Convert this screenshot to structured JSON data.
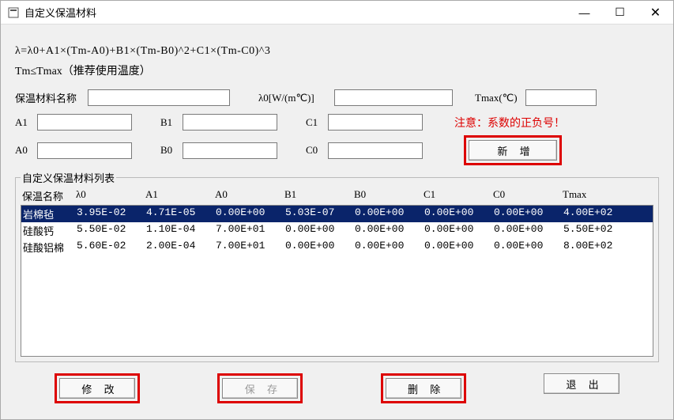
{
  "window": {
    "title": "自定义保温材料"
  },
  "formula": "λ=λ0+A1×(Tm-A0)+B1×(Tm-B0)^2+C1×(Tm-C0)^3",
  "subformula": "Tm≤Tmax（推荐使用温度）",
  "labels": {
    "name": "保温材料名称",
    "lambda0": "λ0[W/(m℃)]",
    "tmax": "Tmax(℃)",
    "a1": "A1",
    "b1": "B1",
    "c1": "C1",
    "a0": "A0",
    "b0": "B0",
    "c0": "C0",
    "warn": "注意：系数的正负号！"
  },
  "inputs": {
    "name": "",
    "lambda0": "",
    "tmax": "",
    "a1": "",
    "b1": "",
    "c1": "",
    "a0": "",
    "b0": "",
    "c0": ""
  },
  "buttons": {
    "add": "新 增",
    "modify": "修 改",
    "save": "保 存",
    "delete": "删 除",
    "exit": "退 出"
  },
  "list": {
    "legend": "自定义保温材料列表",
    "headers": [
      "保温名称",
      "λ0",
      "A1",
      "A0",
      "B1",
      "B0",
      "C1",
      "C0",
      "Tmax"
    ],
    "rows": [
      {
        "name": "岩棉毡",
        "l0": "3.95E-02",
        "a1": "4.71E-05",
        "a0": "0.00E+00",
        "b1": "5.03E-07",
        "b0": "0.00E+00",
        "c1": "0.00E+00",
        "c0": "0.00E+00",
        "tmax": "4.00E+02",
        "selected": true
      },
      {
        "name": "硅酸钙",
        "l0": "5.50E-02",
        "a1": "1.10E-04",
        "a0": "7.00E+01",
        "b1": "0.00E+00",
        "b0": "0.00E+00",
        "c1": "0.00E+00",
        "c0": "0.00E+00",
        "tmax": "5.50E+02",
        "selected": false
      },
      {
        "name": "硅酸铝棉",
        "l0": "5.60E-02",
        "a1": "2.00E-04",
        "a0": "7.00E+01",
        "b1": "0.00E+00",
        "b0": "0.00E+00",
        "c1": "0.00E+00",
        "c0": "0.00E+00",
        "tmax": "8.00E+02",
        "selected": false
      }
    ]
  }
}
